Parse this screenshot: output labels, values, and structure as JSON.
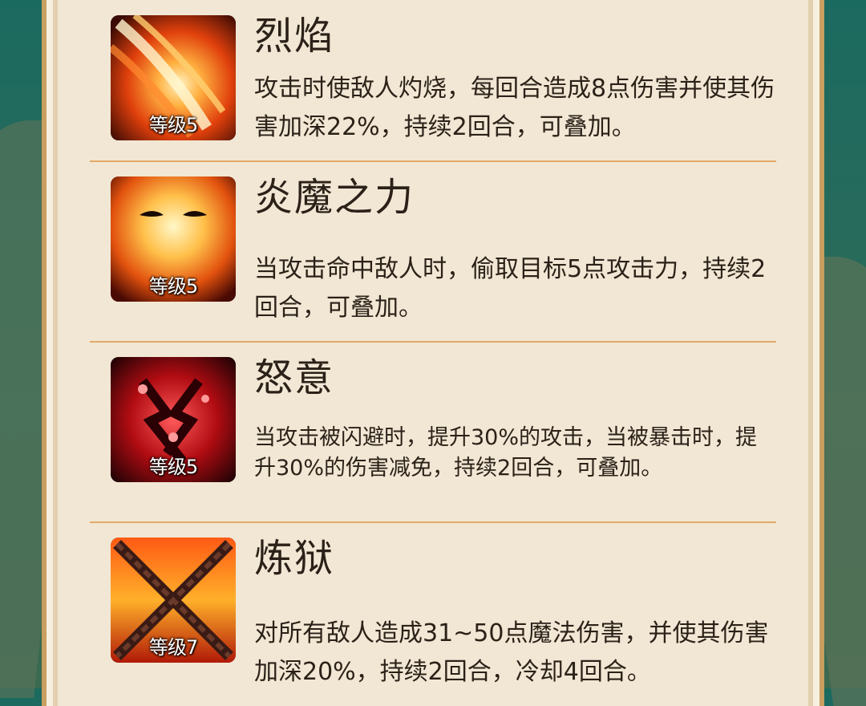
{
  "skills": [
    {
      "name": "烈焰",
      "level": "等级5",
      "icon": "flame-slash-icon",
      "description": "攻击时使敌人灼烧，每回合造成8点伤害并使其伤害加深22%，持续2回合，可叠加。"
    },
    {
      "name": "炎魔之力",
      "level": "等级5",
      "icon": "fire-demon-icon",
      "description": "当攻击命中敌人时，偷取目标5点攻击力，持续2回合，可叠加。"
    },
    {
      "name": "怒意",
      "level": "等级5",
      "icon": "rage-icon",
      "description": "当攻击被闪避时，提升30%的攻击，当被暴击时，提升30%的伤害减免，持续2回合，可叠加。"
    },
    {
      "name": "炼狱",
      "level": "等级7",
      "icon": "chained-inferno-icon",
      "description": "对所有敌人造成31~50点魔法伤害，并使其伤害加深20%，持续2回合，冷却4回合。"
    }
  ],
  "colors": {
    "panel": "#f1e7d4",
    "divider": "#e3a968",
    "text": "#2c2118",
    "frame": "#c99f5f"
  }
}
